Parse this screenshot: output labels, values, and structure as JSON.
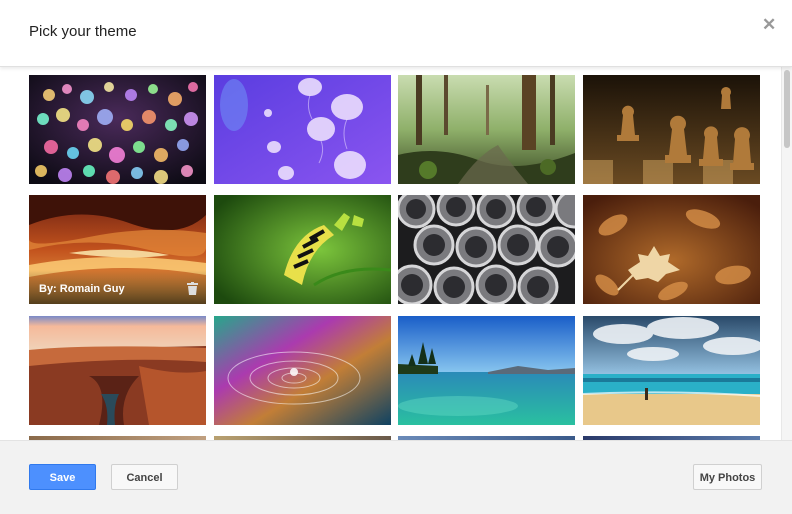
{
  "dialog": {
    "title": "Pick your theme",
    "close_icon": "close-icon"
  },
  "themes": [
    {
      "id": "bokeh-lights"
    },
    {
      "id": "jellyfish"
    },
    {
      "id": "forest"
    },
    {
      "id": "chess"
    },
    {
      "id": "canyon-slot",
      "caption": "By: Romain Guy",
      "has_delete": true
    },
    {
      "id": "caterpillar"
    },
    {
      "id": "pipes"
    },
    {
      "id": "autumn-leaves"
    },
    {
      "id": "grand-canyon"
    },
    {
      "id": "water-drop"
    },
    {
      "id": "lake-shore"
    },
    {
      "id": "beach"
    }
  ],
  "footer": {
    "save_label": "Save",
    "cancel_label": "Cancel",
    "my_photos_label": "My Photos"
  },
  "colors": {
    "accent": "#4d90fe",
    "footer_bg": "#f2f2f2"
  }
}
